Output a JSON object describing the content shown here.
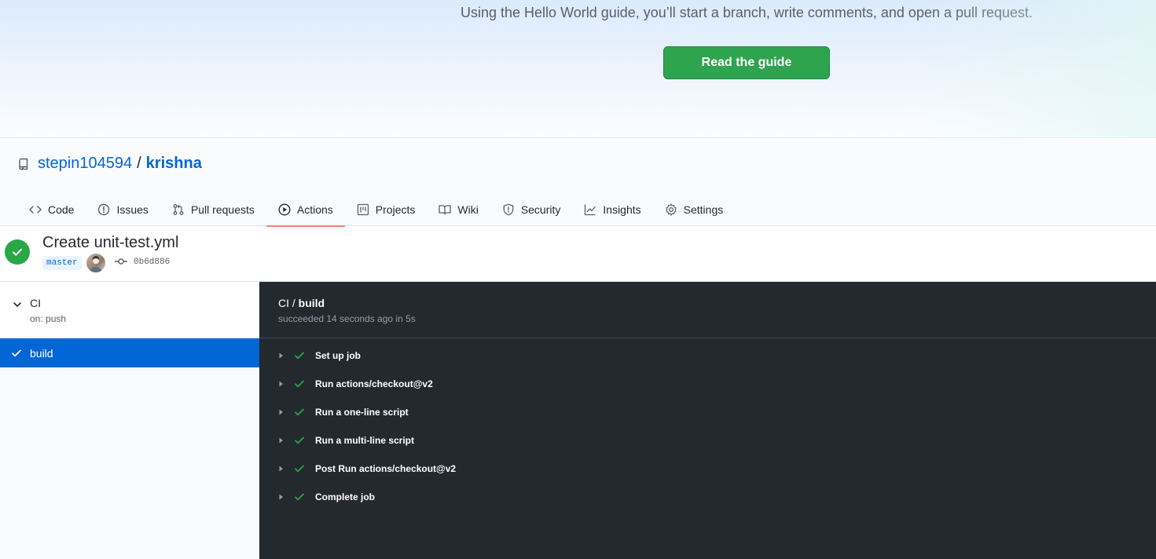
{
  "hero": {
    "text": "Using the Hello World guide, you’ll start a branch, write comments, and open a pull request.",
    "button_label": "Read the guide"
  },
  "repo": {
    "owner": "stepin104594",
    "separator": "/",
    "name": "krishna",
    "icon": "repo-icon"
  },
  "tabs": [
    {
      "label": "Code",
      "icon": "code-icon"
    },
    {
      "label": "Issues",
      "icon": "issue-icon"
    },
    {
      "label": "Pull requests",
      "icon": "pull-request-icon"
    },
    {
      "label": "Actions",
      "icon": "play-icon",
      "selected": true
    },
    {
      "label": "Projects",
      "icon": "project-icon"
    },
    {
      "label": "Wiki",
      "icon": "book-icon"
    },
    {
      "label": "Security",
      "icon": "shield-icon"
    },
    {
      "label": "Insights",
      "icon": "graph-icon"
    },
    {
      "label": "Settings",
      "icon": "gear-icon"
    }
  ],
  "run": {
    "title": "Create unit-test.yml",
    "branch": "master",
    "commit": "0b6d886",
    "status": "success"
  },
  "sidebar": {
    "workflow_name": "CI",
    "workflow_trigger": "on: push",
    "job_name": "build"
  },
  "log": {
    "workflow": "CI / ",
    "job": "build",
    "summary": "succeeded 14 seconds ago in 5s",
    "steps": [
      {
        "name": "Set up job"
      },
      {
        "name": "Run actions/checkout@v2"
      },
      {
        "name": "Run a one-line script"
      },
      {
        "name": "Run a multi-line script"
      },
      {
        "name": "Post Run actions/checkout@v2"
      },
      {
        "name": "Complete job"
      }
    ]
  },
  "colors": {
    "accent": "#0366d6",
    "success": "#28a745",
    "tab_underline": "#f9826c",
    "log_background": "#24292e"
  }
}
